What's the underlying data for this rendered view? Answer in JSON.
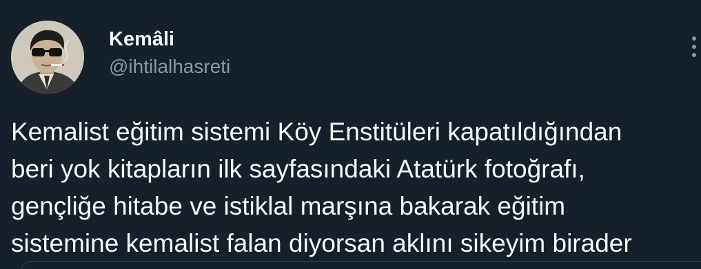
{
  "author": {
    "display_name": "Kemâli",
    "handle": "@ihtilalhasreti",
    "avatar_icon": "profile-photo-man-with-sunglasses"
  },
  "more_icon": "more-vertical-icon",
  "tweet": {
    "lines": [
      "Kemalist eğitim sistemi Köy Enstitüleri kapatıldığından",
      "beri yok kitapların ilk sayfasındaki Atatürk fotoğrafı,",
      "gençliğe hitabe ve istiklal marşına bakarak eğitim",
      "sistemine kemalist falan diyorsan aklını sikeyim birader"
    ]
  },
  "colors": {
    "background": "#15202b",
    "text": "#f7f9f9",
    "secondary": "#8b98a5"
  }
}
